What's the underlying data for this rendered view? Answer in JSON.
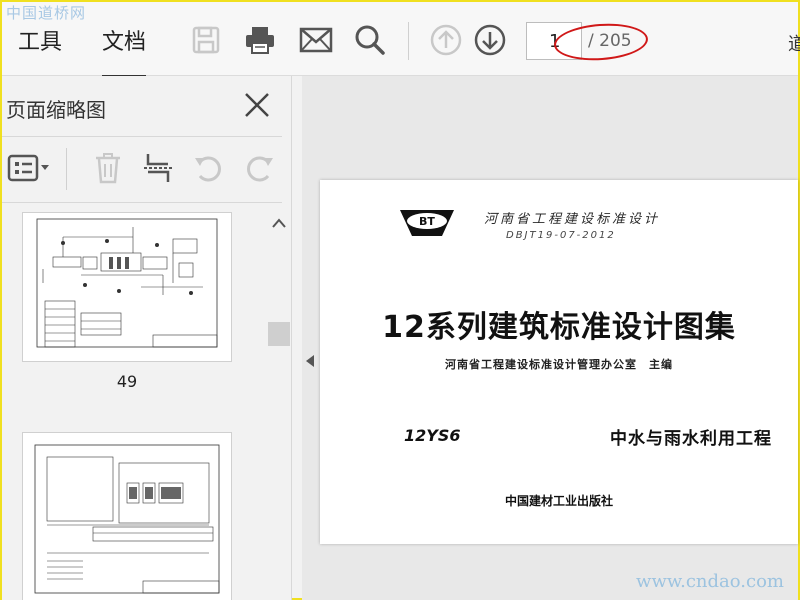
{
  "watermark": {
    "top": "中国道桥网",
    "bottom": "www.cndao.com"
  },
  "toolbar": {
    "tabs": [
      {
        "label": "工具",
        "active": false
      },
      {
        "label": "文档",
        "active": true
      }
    ],
    "icons": [
      "save-icon",
      "print-icon",
      "email-icon",
      "search-icon",
      "arrow-up-icon",
      "arrow-down-icon"
    ],
    "page_current": "1",
    "page_total": "/ 205",
    "annotation_color": "#d01818",
    "far_right_label": "道"
  },
  "sidebar": {
    "title": "页面缩略图",
    "tools": [
      "thumbnail-options-icon",
      "delete-icon",
      "extract-pages-icon",
      "rotate-left-icon",
      "rotate-right-icon"
    ],
    "thumbnails": [
      {
        "label": "49"
      },
      {
        "label": ""
      }
    ]
  },
  "document": {
    "logo_text": "BT",
    "publisher": "河南省工程建设标准设计",
    "code": "DBJT19-07-2012",
    "title": "12系列建筑标准设计图集",
    "organizer": "河南省工程建设标准设计管理办公室　主编",
    "series_code": "12YS6",
    "series_name": "中水与雨水利用工程",
    "press": "中国建材工业出版社"
  },
  "colors": {
    "toolbar_bg": "#f7f7f7",
    "icon_gray": "#555555",
    "icon_disabled": "#c8c8c8",
    "frame": "#f0e020"
  }
}
